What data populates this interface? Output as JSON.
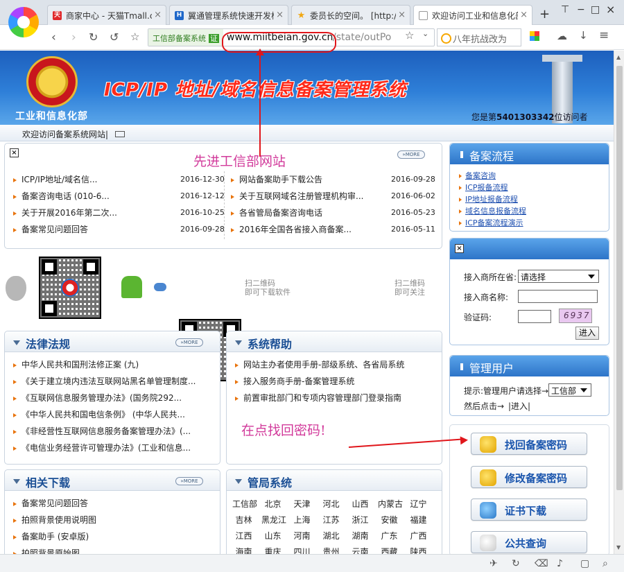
{
  "browser": {
    "tabs": [
      {
        "favicon": "tmall-icon",
        "fav_text": "天",
        "fav_color": "#e0282a",
        "title": "商家中心 - 天猫Tmall.co"
      },
      {
        "favicon": "h-icon",
        "fav_text": "H",
        "fav_color": "#1f67c9",
        "title": "翼通管理系统快速开发框"
      },
      {
        "favicon": "star-icon",
        "fav_text": "★",
        "fav_color": "#f1a712",
        "title": "委员长的空间。 [http://2"
      },
      {
        "favicon": "page-icon",
        "fav_text": "",
        "fav_color": "#ffffff",
        "title": "欢迎访问工业和信息化部"
      }
    ],
    "new_tab": "+",
    "window_controls": [
      "⊤",
      "−",
      "□",
      "×"
    ],
    "address": {
      "security_label": "工信部备案系统",
      "security_badge": "证",
      "host": "www.miitbeian.gov.cn",
      "path": "/state/outPo"
    },
    "search_placeholder": "八年抗战改为"
  },
  "header": {
    "ministry": "工业和信息化部",
    "site_title": "ICP/IP 地址/域名信息备案管理系统",
    "visitor_prefix": "您是第",
    "visitor_count": "5401303342",
    "visitor_suffix": "位访问者"
  },
  "welcome": "欢迎访问备案系统网站|",
  "news": {
    "more": "MORE",
    "left": [
      {
        "title": "ICP/IP地址/域名信...",
        "date": "2016-12-30"
      },
      {
        "title": "备案咨询电话 (010-6...",
        "date": "2016-12-12"
      },
      {
        "title": "关于开展2016年第二次...",
        "date": "2016-10-25"
      },
      {
        "title": "备案常见问题回答",
        "date": "2016-09-28"
      }
    ],
    "right": [
      {
        "title": "网站备案助手下载公告",
        "date": "2016-09-28"
      },
      {
        "title": "关于互联网域名注册管理机构审...",
        "date": "2016-06-02"
      },
      {
        "title": "各省管局备案咨询电话",
        "date": "2016-05-23"
      },
      {
        "title": "2016年全国各省接入商备案...",
        "date": "2016-05-11"
      }
    ]
  },
  "qr": {
    "download_label": "扫二维码\n即可下载软件",
    "follow_label": "扫二维码\n即可关注"
  },
  "laws": {
    "title": "法律法规",
    "more": "MORE",
    "items": [
      "中华人民共和国刑法修正案 (九)",
      "《关于建立境内违法互联网站黑名单管理制度...",
      "《互联网信息服务管理办法》(国务院292...",
      "《中华人民共和国电信条例》 (中华人民共...",
      "《非经营性互联网信息服务备案管理办法》(...",
      "《电信业务经营许可管理办法》(工业和信息..."
    ]
  },
  "help": {
    "title": "系统帮助",
    "items": [
      "网站主办者使用手册-部级系统、各省局系统",
      "接入服务商手册-备案管理系统",
      "前置审批部门和专项内容管理部门登录指南"
    ]
  },
  "downloads": {
    "title": "相关下载",
    "more": "MORE",
    "items": [
      "备案常见问题回答",
      "拍照背景使用说明图",
      "备案助手 (安卓版)",
      "拍照背景原始图"
    ]
  },
  "bureaus": {
    "title": "管局系统",
    "provinces": [
      "工信部",
      "北京",
      "天津",
      "河北",
      "山西",
      "内蒙古",
      "辽宁",
      "吉林",
      "黑龙江",
      "上海",
      "江苏",
      "浙江",
      "安徽",
      "福建",
      "江西",
      "山东",
      "河南",
      "湖北",
      "湖南",
      "广东",
      "广西",
      "海南",
      "重庆",
      "四川",
      "贵州",
      "云南",
      "西藏",
      "陕西"
    ]
  },
  "sidebar": {
    "flow_title": "备案流程",
    "flow_links": [
      "备案咨询",
      "ICP报备流程",
      "IP地址报备流程",
      "域名信息报备流程",
      "ICP备案流程演示"
    ],
    "login": {
      "province_label": "接入商所在省:",
      "province_value": "请选择",
      "name_label": "接入商名称:",
      "captcha_label": "验证码:",
      "captcha_value": "6937",
      "submit": "进入"
    },
    "admin_title": "管理用户",
    "admin_hint": "提示:管理用户请选择→",
    "admin_select": "工信部",
    "admin_then": "然后点击→",
    "admin_enter": "|进入|",
    "buttons": [
      "找回备案密码",
      "修改备案密码",
      "证书下载",
      "公共查询"
    ]
  },
  "annotations": {
    "top": "先进工信部网站",
    "mid": "在点找回密码!",
    "color": "#d23b9b",
    "arrow_color": "#e0161b"
  }
}
